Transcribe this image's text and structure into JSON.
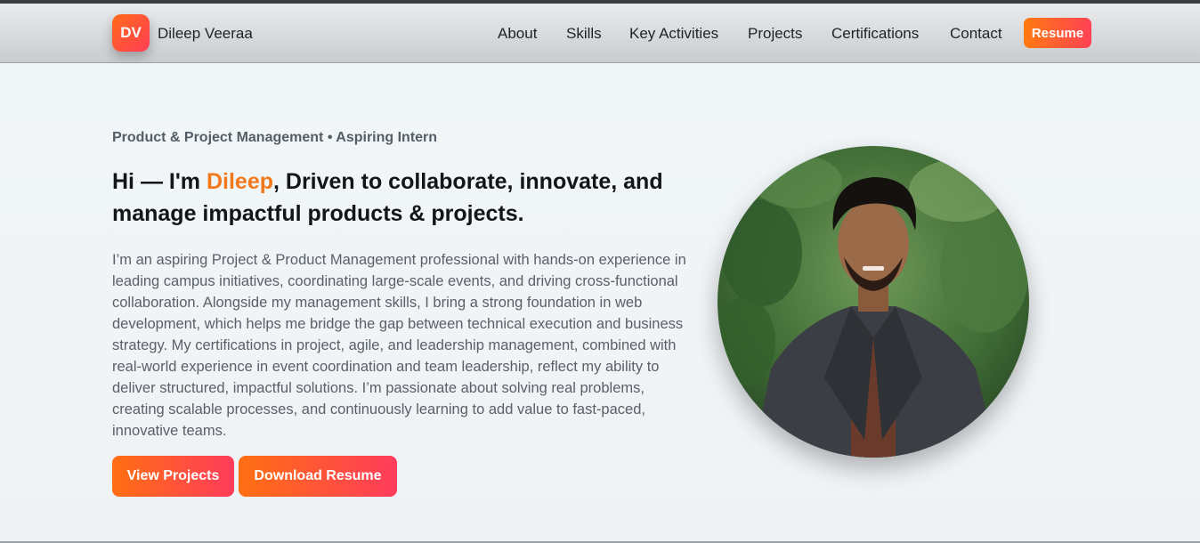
{
  "nav": {
    "logo_text": "DV",
    "brand": "Dileep Veeraa",
    "links": [
      "About",
      "Skills",
      "Key Activities",
      "Projects",
      "Certifications",
      "Contact"
    ],
    "resume_label": "Resume"
  },
  "hero": {
    "eyebrow": "Product & Project Management • Aspiring Intern",
    "headline_pre": "Hi — I'm ",
    "headline_name": "Dileep",
    "headline_post": ", Driven to collaborate, innovate, and manage impactful products & projects.",
    "intro": "I’m an aspiring Project & Product Management professional with hands-on experience in leading campus initiatives, coordinating large-scale events, and driving cross-functional collaboration. Alongside my management skills, I bring a strong foundation in web development, which helps me bridge the gap between technical execution and business strategy. My certifications in project, agile, and leadership management, combined with real-world experience in event coordination and team leadership, reflect my ability to deliver structured, impactful solutions. I’m passionate about solving real problems, creating scalable processes, and continuously learning to add value to fast-paced, innovative teams.",
    "buttons": {
      "projects": "View Projects",
      "download": "Download Resume"
    }
  },
  "colors": {
    "accent": "#f2781a",
    "button_start": "#ff6f12",
    "button_end": "#ff3c5b"
  }
}
